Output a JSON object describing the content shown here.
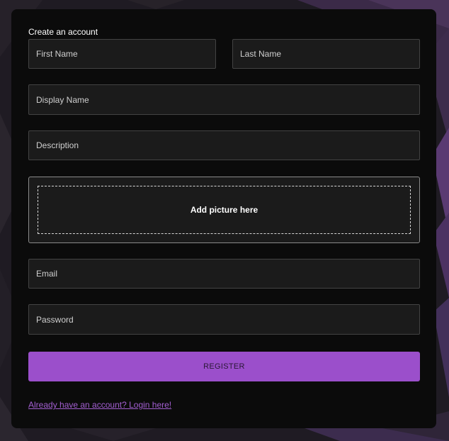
{
  "form": {
    "title": "Create an account",
    "first_name_placeholder": "First Name",
    "last_name_placeholder": "Last Name",
    "display_name_placeholder": "Display Name",
    "description_placeholder": "Description",
    "picture_label": "Add picture here",
    "email_placeholder": "Email",
    "password_placeholder": "Password",
    "register_label": "REGISTER",
    "login_link": "Already have an account? Login here!"
  },
  "colors": {
    "accent": "#9b4fcb",
    "link": "#a35fd1",
    "card_background": "#0b0b0b",
    "field_background": "#1b1b1b"
  }
}
